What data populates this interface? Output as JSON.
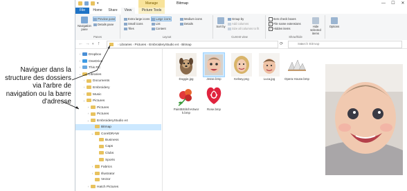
{
  "annotation": {
    "lines": [
      "Naviguer dans la",
      "structure des dossiers",
      "via l'arbre de",
      "navigation ou la barre",
      "d'adresse"
    ]
  },
  "window": {
    "title": "Bitmap",
    "context_tab": "Manage",
    "controls": {
      "minimize": "—",
      "maximize": "☐",
      "close": "✕"
    }
  },
  "tabs": [
    "File",
    "Home",
    "Share",
    "View",
    "Picture Tools"
  ],
  "ribbon": {
    "panes": {
      "group": "Panes",
      "navigation_pane": "Navigation pane",
      "preview_pane": "Preview pane",
      "details_pane": "Details pane"
    },
    "layout": {
      "group": "Layout",
      "items": [
        "Extra large icons",
        "Large icons",
        "Medium icons",
        "Small icons",
        "List",
        "Details",
        "Tiles",
        "Content"
      ]
    },
    "current_view": {
      "group": "Current view",
      "sort_by": "Sort by",
      "group_by": "Group by",
      "add_columns": "Add columns",
      "size_columns": "Size all columns to fit"
    },
    "show_hide": {
      "group": "Show/hide",
      "item_check_boxes": "Item check boxes",
      "file_name_extensions": "File name extensions",
      "hidden_items": "Hidden items",
      "hide_selected": "Hide selected items"
    },
    "options": "Options"
  },
  "address": {
    "crumbs": [
      "Libraries",
      "Pictures",
      "EmbroideryStudio e4",
      "Bitmap"
    ],
    "search_placeholder": "Search Bitmap"
  },
  "nav_tree": [
    {
      "label": "Dropbox",
      "indent": 1,
      "icon": "blue",
      "twisty": ">"
    },
    {
      "label": "OneDrive",
      "indent": 1,
      "icon": "sky",
      "twisty": ">"
    },
    {
      "label": "This PC",
      "indent": 1,
      "icon": "pc",
      "twisty": ">"
    },
    {
      "label": "Libraries",
      "indent": 1,
      "icon": "plain",
      "twisty": "v"
    },
    {
      "label": "Documents",
      "indent": 2,
      "icon": "plain",
      "twisty": ">"
    },
    {
      "label": "Embroidery",
      "indent": 2,
      "icon": "plain",
      "twisty": ">"
    },
    {
      "label": "Music",
      "indent": 2,
      "icon": "plain",
      "twisty": ">"
    },
    {
      "label": "Pictures",
      "indent": 2,
      "icon": "plain",
      "twisty": "v"
    },
    {
      "label": "Pictures",
      "indent": 3,
      "icon": "plain",
      "twisty": ">"
    },
    {
      "label": "Pictures",
      "indent": 3,
      "icon": "plain",
      "twisty": ">"
    },
    {
      "label": "EmbroideryStudio e4",
      "indent": 3,
      "icon": "plain",
      "twisty": "v"
    },
    {
      "label": "Bitmap",
      "indent": 4,
      "icon": "plain",
      "twisty": "",
      "selected": true
    },
    {
      "label": "CorelDRAW",
      "indent": 4,
      "icon": "plain",
      "twisty": "v"
    },
    {
      "label": "Business",
      "indent": 5,
      "icon": "plain",
      "twisty": ""
    },
    {
      "label": "Caps",
      "indent": 5,
      "icon": "plain",
      "twisty": ""
    },
    {
      "label": "Clubs",
      "indent": 5,
      "icon": "plain",
      "twisty": ""
    },
    {
      "label": "Sports",
      "indent": 5,
      "icon": "plain",
      "twisty": ""
    },
    {
      "label": "Fabrics",
      "indent": 4,
      "icon": "plain",
      "twisty": ">"
    },
    {
      "label": "Illustrator",
      "indent": 4,
      "icon": "plain",
      "twisty": ">"
    },
    {
      "label": "Vector",
      "indent": 4,
      "icon": "plain",
      "twisty": ""
    },
    {
      "label": "Hatch Pictures",
      "indent": 3,
      "icon": "plain",
      "twisty": ">"
    }
  ],
  "files": [
    {
      "name": "Doggie.jpg",
      "kind": "dog"
    },
    {
      "name": "Jesse.bmp",
      "kind": "baby",
      "selected": true
    },
    {
      "name": "Kelsey.png",
      "kind": "girl"
    },
    {
      "name": "Luca.jpg",
      "kind": "boy"
    },
    {
      "name": "Opera House.bmp",
      "kind": "opera"
    },
    {
      "name": "PaintBStitchArtwork.bmp",
      "kind": "art"
    },
    {
      "name": "Rose.bmp",
      "kind": "rose"
    }
  ],
  "colors": {
    "file_tab": "#1e73c6",
    "selection": "#cce8ff",
    "manage_tab": "#f8e39a",
    "folder": "#e8c25e"
  }
}
